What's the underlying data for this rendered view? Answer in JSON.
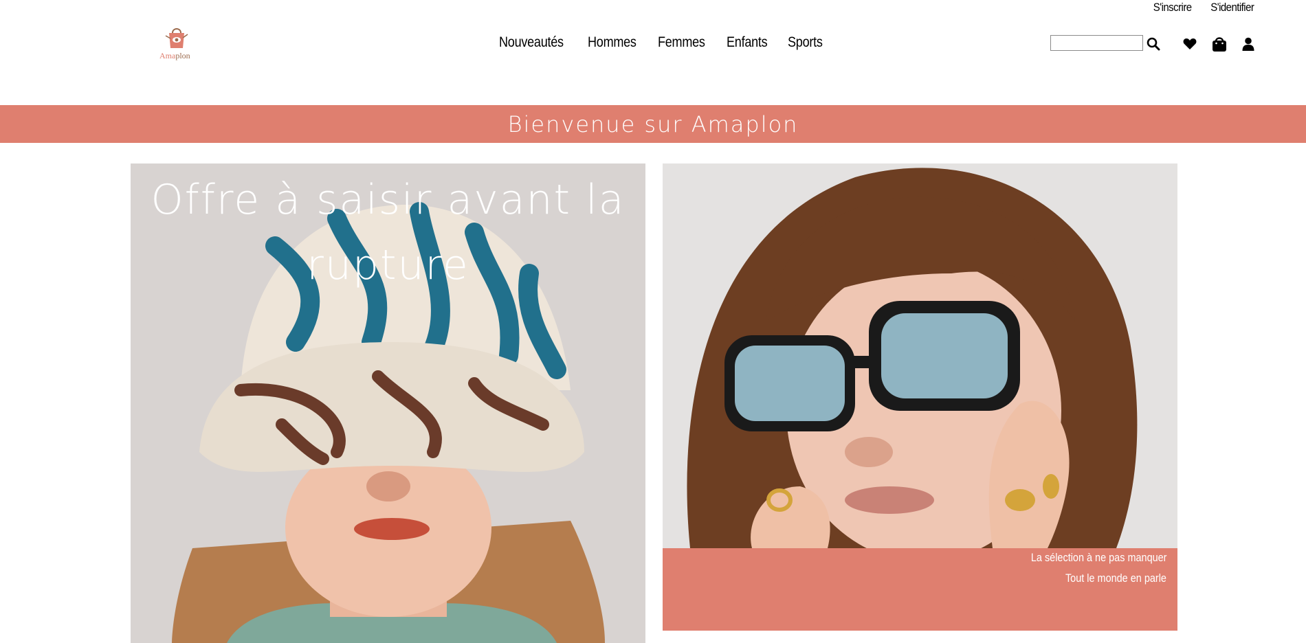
{
  "account": {
    "signup_label": "S'inscrire",
    "login_label": "S'identifier"
  },
  "logo": {
    "text_part1": "Ama",
    "text_part2": "plon",
    "icon": "shopping-bag-logo-icon"
  },
  "nav": {
    "items": [
      {
        "label": "Nouveautés"
      },
      {
        "label": "Hommes"
      },
      {
        "label": "Femmes"
      },
      {
        "label": "Enfants"
      },
      {
        "label": "Sports"
      }
    ]
  },
  "search": {
    "value": "",
    "placeholder": "",
    "icon": "search-icon"
  },
  "header_icons": [
    "heart-icon",
    "shopping-bag-icon",
    "user-icon"
  ],
  "welcome_banner": {
    "text": "Bienvenue sur Amaplon"
  },
  "hero_left": {
    "title": "Offre à saisir avant la rupture",
    "image": "woman-in-bucket-hat-photo"
  },
  "hero_right": {
    "image": "woman-with-sunglasses-photo",
    "caption_line1": "La sélection à ne pas manquer",
    "caption_line2": "Tout le monde en parle"
  },
  "colors": {
    "accent": "#df7f6f",
    "text": "#000000",
    "background": "#ffffff"
  }
}
